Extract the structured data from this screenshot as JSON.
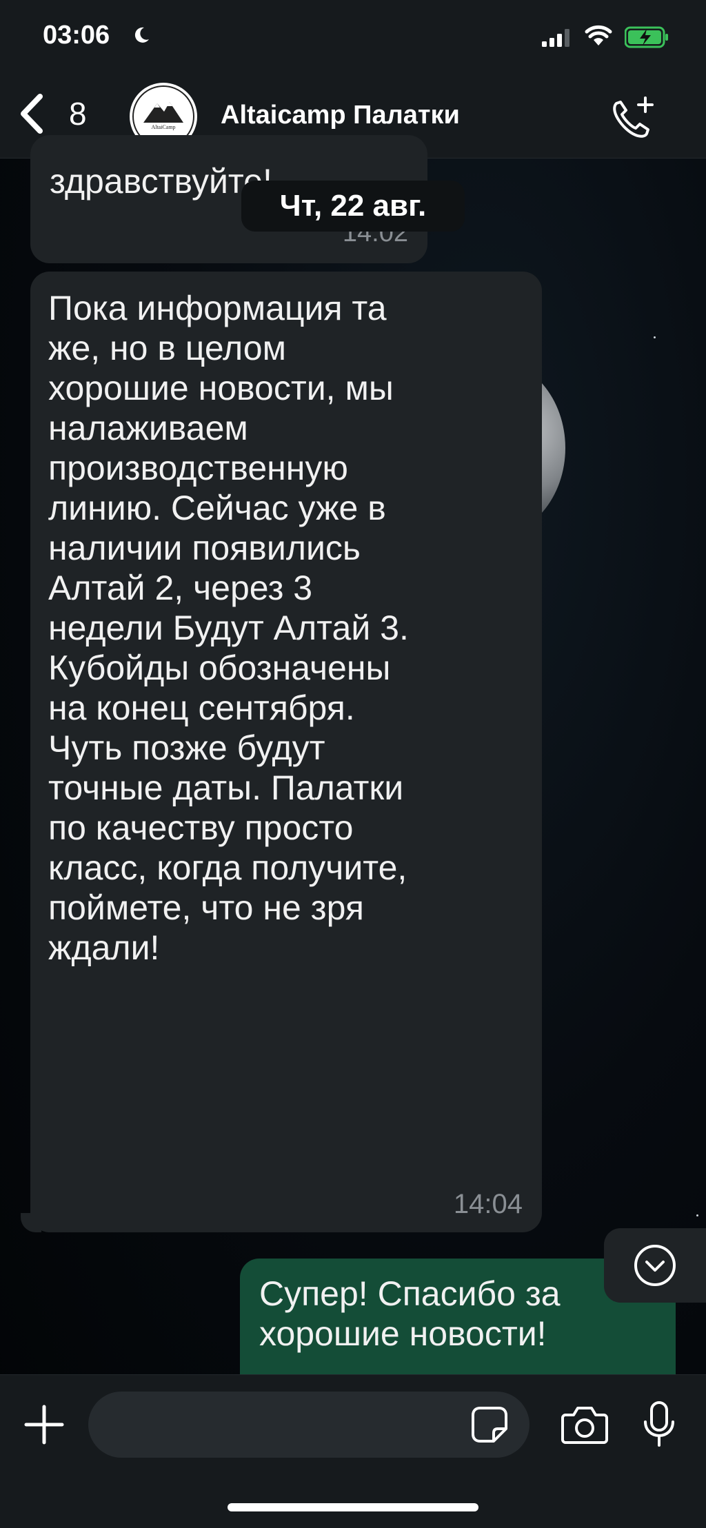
{
  "status_bar": {
    "time": "03:06",
    "icons": [
      "moon-icon",
      "signal-icon",
      "wifi-icon",
      "battery-charging-icon"
    ]
  },
  "header": {
    "back_count": "8",
    "avatar_text": "AltaiCamp",
    "title": "Altaicamp Палатки",
    "action_icon": "add-call-icon"
  },
  "messages": {
    "previous": {
      "text": "здравствуйте!",
      "time": "14:02",
      "direction": "incoming"
    },
    "date_chip": "Чт, 22 авг.",
    "main": {
      "lines": [
        "Пока информация та",
        "же, но в целом",
        "хорошие новости, мы",
        "налаживаем",
        "производственную",
        "линию. Сейчас уже в",
        "наличии появились",
        "Алтай 2, через 3",
        "недели Будут Алтай 3.",
        "Кубойды обозначены",
        "на конец сентября.",
        "Чуть позже будут",
        "точные даты. Палатки",
        "по качеству просто",
        "класс, когда получите,",
        "поймете, что не зря",
        "ждали!"
      ],
      "time": "14:04",
      "direction": "incoming"
    },
    "outgoing": {
      "lines": [
        "Супер! Спасибо за",
        "хорошие новости!"
      ],
      "direction": "outgoing"
    }
  },
  "input_bar": {
    "placeholder": "",
    "icons": [
      "plus-icon",
      "sticker-icon",
      "camera-icon",
      "microphone-icon"
    ]
  },
  "colors": {
    "bar_bg": "#161a1d",
    "incoming_bubble": "#1f2326",
    "outgoing_bubble": "#144d37",
    "timestamp": "#8a8f94"
  }
}
